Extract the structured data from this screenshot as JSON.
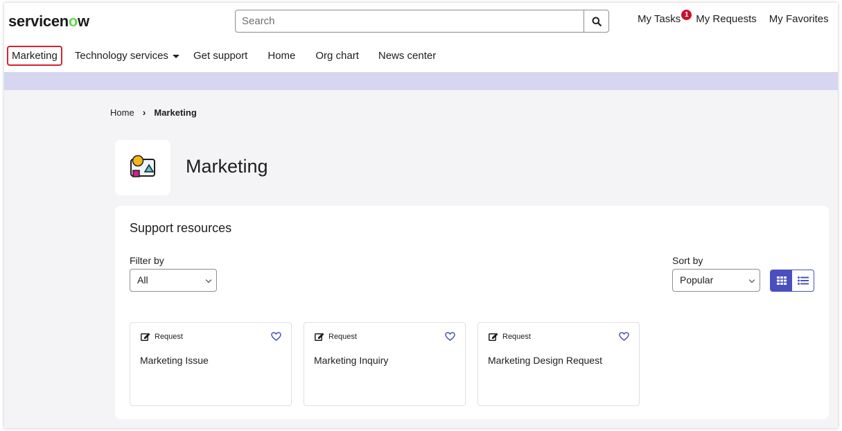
{
  "header": {
    "logo_pre": "servicen",
    "logo_o": "o",
    "logo_post": "w",
    "search_placeholder": "Search",
    "links": {
      "my_tasks": "My Tasks",
      "my_tasks_badge": "1",
      "my_requests": "My Requests",
      "my_favorites": "My Favorites"
    }
  },
  "nav": {
    "items": [
      "Marketing",
      "Technology services",
      "Get support",
      "Home",
      "Org chart",
      "News center"
    ]
  },
  "breadcrumb": {
    "home": "Home",
    "current": "Marketing"
  },
  "page": {
    "title": "Marketing"
  },
  "resources": {
    "heading": "Support resources",
    "filter_label": "Filter by",
    "filter_value": "All",
    "sort_label": "Sort by",
    "sort_value": "Popular",
    "items": [
      {
        "type": "Request",
        "name": "Marketing Issue"
      },
      {
        "type": "Request",
        "name": "Marketing Inquiry"
      },
      {
        "type": "Request",
        "name": "Marketing Design Request"
      }
    ]
  },
  "colors": {
    "accent": "#4a4fbf",
    "band": "#d6d6f0",
    "highlight": "#d8222c",
    "badge": "#c8102e",
    "logo_green": "#62d84e"
  },
  "icons": [
    "search-icon",
    "caret-down-icon",
    "chevron-right-icon",
    "marketing-category-icon",
    "chevron-down-icon",
    "grid-view-icon",
    "list-view-icon",
    "edit-request-icon",
    "heart-icon"
  ]
}
